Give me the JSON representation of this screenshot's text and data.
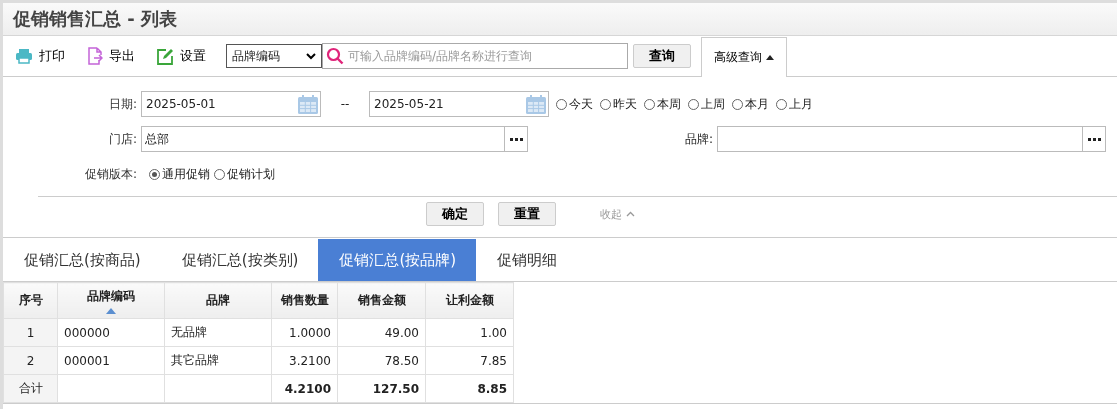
{
  "window": {
    "title": "促销销售汇总 - 列表"
  },
  "toolbar": {
    "actions": [
      {
        "label": "打印",
        "kind": "print"
      },
      {
        "label": "导出",
        "kind": "export"
      },
      {
        "label": "设置",
        "kind": "settings"
      }
    ],
    "search_by": "品牌编码",
    "search": {
      "placeholder": "可输入品牌编码/品牌名称进行查询"
    },
    "search_button": "查询",
    "advanced_button": {
      "label": "高级查询",
      "expanded": true
    }
  },
  "filters": {
    "date_label": "日期:",
    "date_from": "2025-05-01",
    "date_separator": "--",
    "date_to": "2025-05-21",
    "quick_dates": [
      {
        "label": "今天",
        "selected": false
      },
      {
        "label": "昨天",
        "selected": false
      },
      {
        "label": "本周",
        "selected": false
      },
      {
        "label": "上周",
        "selected": false
      },
      {
        "label": "本月",
        "selected": false
      },
      {
        "label": "上月",
        "selected": false
      }
    ],
    "store_label": "门店:",
    "store": "总部",
    "brand_label": "品牌:",
    "version_label": "促销版本:",
    "versions": [
      {
        "label": "通用促销",
        "selected": true
      },
      {
        "label": "促销计划",
        "selected": false
      }
    ],
    "confirm_button": "确定",
    "reset_button": "重置",
    "collapse": "收起"
  },
  "tabs": [
    {
      "label": "促销汇总(按商品)",
      "selected": false
    },
    {
      "label": "促销汇总(按类别)",
      "selected": false
    },
    {
      "label": "促销汇总(按品牌)",
      "selected": true
    },
    {
      "label": "促销明细",
      "selected": false
    }
  ],
  "table": {
    "columns": [
      {
        "label": "序号",
        "sorted": false
      },
      {
        "label": "品牌编码",
        "sorted": true
      },
      {
        "label": "品牌",
        "sorted": false
      },
      {
        "label": "销售数量",
        "sorted": false
      },
      {
        "label": "销售金额",
        "sorted": false
      },
      {
        "label": "让利金额",
        "sorted": false
      }
    ],
    "rows": [
      [
        "1",
        "000000",
        "无品牌",
        "1.0000",
        "49.00",
        "1.00"
      ],
      [
        "2",
        "000001",
        "其它品牌",
        "3.2100",
        "78.50",
        "7.85"
      ]
    ],
    "total": {
      "label": "合计",
      "quantity": "4.2100",
      "amount": "127.50",
      "discount": "8.85"
    }
  }
}
